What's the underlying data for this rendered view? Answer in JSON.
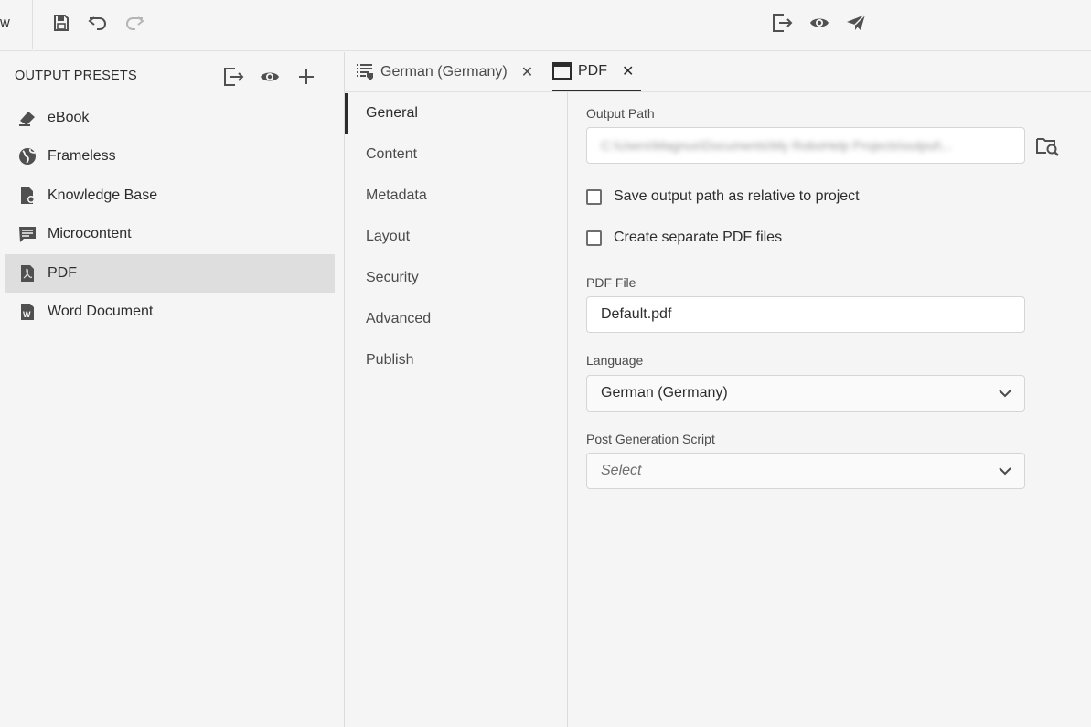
{
  "toolbar": {
    "cut_label": "w",
    "icons": [
      "save-icon",
      "undo-icon",
      "redo-icon",
      "export-icon",
      "preview-icon",
      "publish-icon"
    ]
  },
  "left_panel": {
    "title": "OUTPUT PRESETS",
    "actions": [
      "export-icon",
      "preview-icon",
      "add-icon"
    ],
    "presets": [
      {
        "label": "eBook",
        "icon": "ebook-icon"
      },
      {
        "label": "Frameless",
        "icon": "globe-icon"
      },
      {
        "label": "Knowledge Base",
        "icon": "knowledge-base-icon"
      },
      {
        "label": "Microcontent",
        "icon": "microcontent-icon"
      },
      {
        "label": "PDF",
        "icon": "pdf-icon",
        "selected": true
      },
      {
        "label": "Word Document",
        "icon": "word-icon"
      }
    ]
  },
  "tabs": [
    {
      "label": "German (Germany)",
      "close": "✕",
      "icon": "language-list-icon"
    },
    {
      "label": "PDF",
      "close": "✕",
      "icon": "window-icon",
      "active": true
    }
  ],
  "settings_nav": [
    {
      "label": "General",
      "active": true
    },
    {
      "label": "Content"
    },
    {
      "label": "Metadata"
    },
    {
      "label": "Layout"
    },
    {
      "label": "Security"
    },
    {
      "label": "Advanced"
    },
    {
      "label": "Publish"
    }
  ],
  "form": {
    "output_path_label": "Output Path",
    "output_path_value": "C:\\Users\\Magnus\\Documents\\My RoboHelp Projects\\output\\...",
    "save_relative_label": "Save output path as relative to project",
    "save_relative_checked": false,
    "separate_pdf_label": "Create separate PDF files",
    "separate_pdf_checked": false,
    "pdf_file_label": "PDF File",
    "pdf_file_value": "Default.pdf",
    "language_label": "Language",
    "language_value": "German (Germany)",
    "post_script_label": "Post Generation Script",
    "post_script_placeholder": "Select"
  },
  "colors": {
    "background": "#f5f5f5",
    "selected_row": "#dedede",
    "text": "#2c2c2c",
    "icon": "#505050"
  }
}
